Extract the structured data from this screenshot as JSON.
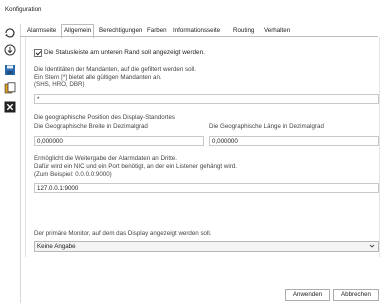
{
  "window": {
    "title": "Konfiguration"
  },
  "tabs": [
    {
      "label": "Alarmseite"
    },
    {
      "label": "Allgemein"
    },
    {
      "label": "Berechtigungen"
    },
    {
      "label": "Farben"
    },
    {
      "label": "Informationsseite"
    },
    {
      "label": "Routing"
    },
    {
      "label": "Verhalten"
    }
  ],
  "active_tab": "Allgemein",
  "general": {
    "statusbar_checkbox": {
      "label": "Die Statusleiste am unteren Rand soll angezeigt werden.",
      "checked": true
    },
    "clients": {
      "desc_line1": "Die Identitäten der Mandanten, auf die gefiltert werden soll.",
      "desc_line2": "Ein Stern [*] bietet alle gültigen Mandanten an.",
      "desc_line3": "(SHS, HRO, DBR)",
      "value": "*"
    },
    "geo": {
      "heading": "Die geographische Position des Display-Standortes",
      "lat_label": "Die Geographische Breite in Dezimalgrad",
      "lat_value": "0,000000",
      "lon_label": "Die Geographische Länge in Dezimalgrad",
      "lon_value": "0,000000"
    },
    "forward": {
      "desc_line1": "Ermöglicht die Weitergabe der Alarmdaten an Dritte.",
      "desc_line2": "Dafür wird ein NIC und ein Port benötigt, an der ein Listener gehängt wird.",
      "desc_line3": "(Zum Beispiel: 0.0.0.0:9000)",
      "value": "127.0.0.1:9000"
    },
    "monitor": {
      "label": "Der primäre Monitor, auf dem das Display angezeigt werden soll.",
      "selected": "Keine Angabe"
    }
  },
  "buttons": {
    "apply": "Anwenden",
    "cancel": "Abbrechen"
  },
  "icons": {
    "toolbar": [
      "refresh-icon",
      "download-icon",
      "save-icon",
      "export-icon",
      "close-icon"
    ],
    "accent": "#2b6cb0"
  }
}
